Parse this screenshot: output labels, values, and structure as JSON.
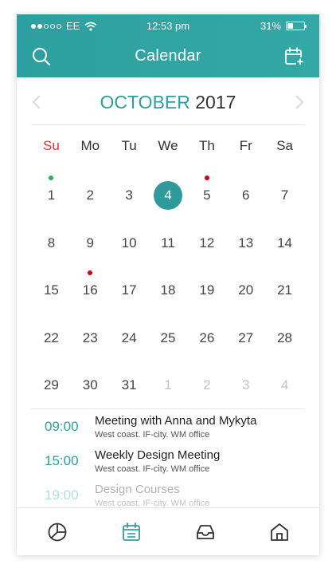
{
  "status": {
    "carrier": "EE",
    "time": "12:53 pm",
    "battery_text": "31%",
    "battery_level": 0.31,
    "signal_bars": 2
  },
  "header": {
    "title": "Calendar",
    "left_icon": "search-icon",
    "right_icon": "calendar-add-icon"
  },
  "calendar": {
    "month": "OCTOBER",
    "year": "2017",
    "weekdays": [
      "Su",
      "Mo",
      "Tu",
      "We",
      "Th",
      "Fr",
      "Sa"
    ],
    "days": [
      {
        "n": "1",
        "dot": "#2bb24c"
      },
      {
        "n": "2"
      },
      {
        "n": "3"
      },
      {
        "n": "4",
        "today": true
      },
      {
        "n": "5",
        "dot": "#d0021b"
      },
      {
        "n": "6"
      },
      {
        "n": "7"
      },
      {
        "n": "8"
      },
      {
        "n": "9"
      },
      {
        "n": "10"
      },
      {
        "n": "11"
      },
      {
        "n": "12"
      },
      {
        "n": "13"
      },
      {
        "n": "14"
      },
      {
        "n": "15"
      },
      {
        "n": "16",
        "dot": "#d0021b"
      },
      {
        "n": "17"
      },
      {
        "n": "18"
      },
      {
        "n": "19"
      },
      {
        "n": "20"
      },
      {
        "n": "21"
      },
      {
        "n": "22"
      },
      {
        "n": "23"
      },
      {
        "n": "24"
      },
      {
        "n": "25"
      },
      {
        "n": "26"
      },
      {
        "n": "27"
      },
      {
        "n": "28"
      },
      {
        "n": "29"
      },
      {
        "n": "30"
      },
      {
        "n": "31"
      },
      {
        "n": "1",
        "muted": true
      },
      {
        "n": "2",
        "muted": true
      },
      {
        "n": "3",
        "muted": true
      },
      {
        "n": "4",
        "muted": true
      }
    ]
  },
  "events": [
    {
      "time": "09:00",
      "title": "Meeting with Anna and Mykyta",
      "location": "West coast. IF-city. WM office"
    },
    {
      "time": "15:00",
      "title": "Weekly Design Meeting",
      "location": "West coast. IF-city. WM office"
    },
    {
      "time": "19:00",
      "title": "Design Courses",
      "location": "West coast. IF-city. WM office",
      "faded": true
    }
  ],
  "tabs": [
    "stats-icon",
    "calendar-icon",
    "inbox-icon",
    "home-icon"
  ],
  "colors": {
    "accent": "#2e9fa0",
    "sunday": "#e8312f",
    "active_tab": "#2e9fa0",
    "inactive_tab": "#333333"
  }
}
